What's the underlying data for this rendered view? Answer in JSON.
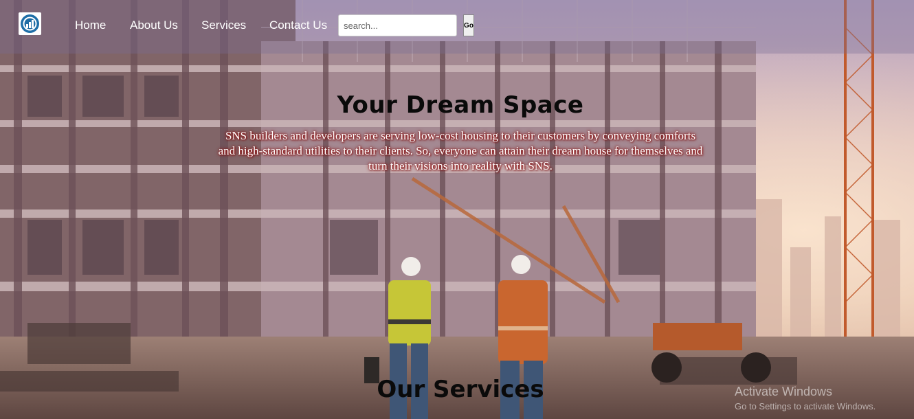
{
  "nav": {
    "logo_icon": "building-chart-logo-icon",
    "links": [
      "Home",
      "About Us",
      "Services",
      "Contact Us"
    ],
    "search": {
      "placeholder": "search...",
      "value": ""
    },
    "go_label": "Go"
  },
  "hero": {
    "title": "Your Dream Space",
    "text": "SNS builders and developers are serving low-cost housing to their customers by conveying comforts and high-standard utilities to their clients. So, everyone can attain their dream house for themselves and turn their visions into reality with SNS."
  },
  "services": {
    "title": "Our Services"
  },
  "watermark": {
    "title": "Activate Windows",
    "subtitle": "Go to Settings to activate Windows."
  },
  "colors": {
    "nav_text": "#ffffff",
    "heading": "#0a0a0a",
    "hero_text": "#ffffff",
    "hero_text_glow": "#961414"
  }
}
